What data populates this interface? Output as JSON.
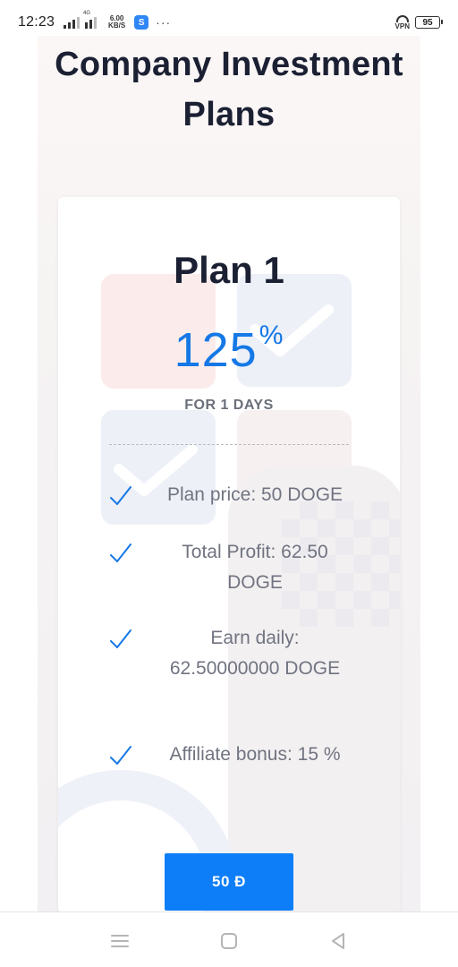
{
  "status_bar": {
    "time": "12:23",
    "signal_tiny_label": "4G",
    "net_speed_value": "6.00",
    "net_speed_unit": "KB/S",
    "app_badge": "S",
    "more": "···",
    "vpn_label": "VPN",
    "battery_level": "95"
  },
  "page": {
    "heading": "Company Investment Plans"
  },
  "plan": {
    "title": "Plan 1",
    "rate_value": "125",
    "rate_unit": "%",
    "duration": "FOR 1 DAYS",
    "features": [
      {
        "text": "Plan price: 50 DOGE",
        "icon": "check-icon"
      },
      {
        "text": "Total Profit: 62.50 DOGE",
        "icon": "check-icon"
      },
      {
        "text": "Earn daily: 62.50000000 DOGE",
        "icon": "check-icon"
      },
      {
        "text": "Affiliate bonus: 15 %",
        "icon": "check-icon"
      }
    ],
    "button_label": "50 Ð"
  },
  "nav_bar": {
    "icons": [
      "menu-icon",
      "home-square-icon",
      "back-triangle-icon"
    ]
  },
  "colors": {
    "accent": "#1578e6",
    "button": "#0d7ef7",
    "heading": "#1b2033",
    "body_text": "#707480"
  }
}
